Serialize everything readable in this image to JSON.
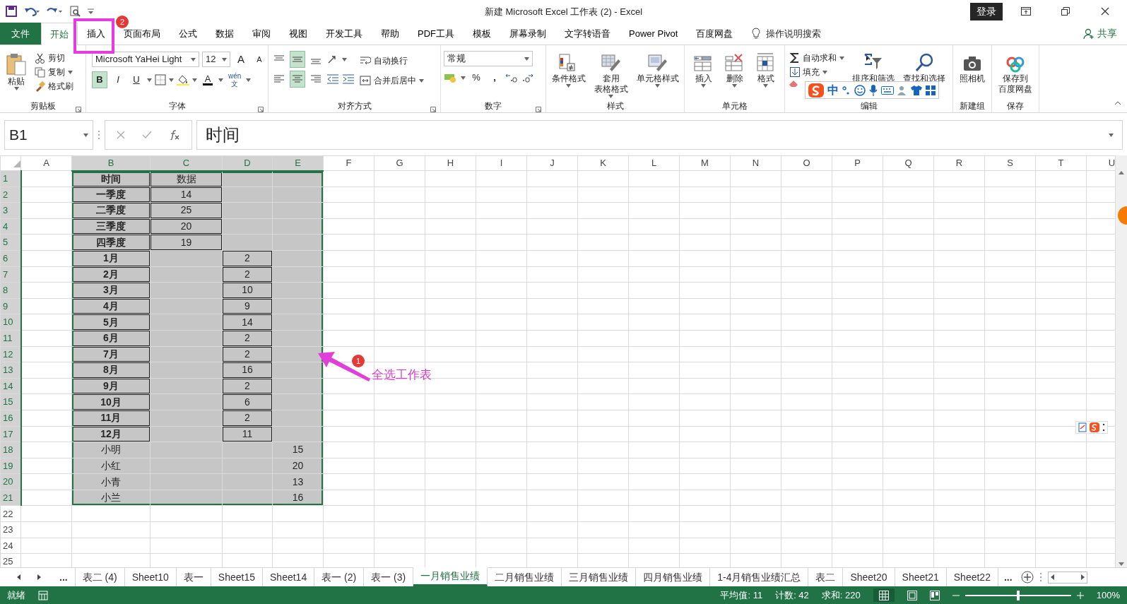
{
  "title_bar": {
    "title": "新建 Microsoft Excel 工作表 (2)  -  Excel",
    "login": "登录"
  },
  "ribbon_tabs": [
    {
      "label": "文件",
      "kind": "file",
      "selected": false
    },
    {
      "label": "开始",
      "kind": "tab",
      "selected": true
    },
    {
      "label": "插入",
      "kind": "tab",
      "selected": false
    },
    {
      "label": "页面布局",
      "kind": "tab",
      "selected": false
    },
    {
      "label": "公式",
      "kind": "tab",
      "selected": false
    },
    {
      "label": "数据",
      "kind": "tab",
      "selected": false
    },
    {
      "label": "审阅",
      "kind": "tab",
      "selected": false
    },
    {
      "label": "视图",
      "kind": "tab",
      "selected": false
    },
    {
      "label": "开发工具",
      "kind": "tab",
      "selected": false
    },
    {
      "label": "帮助",
      "kind": "tab",
      "selected": false
    },
    {
      "label": "PDF工具",
      "kind": "tab",
      "selected": false
    },
    {
      "label": "模板",
      "kind": "tab",
      "selected": false
    },
    {
      "label": "屏幕录制",
      "kind": "tab",
      "selected": false
    },
    {
      "label": "文字转语音",
      "kind": "tab",
      "selected": false
    },
    {
      "label": "Power Pivot",
      "kind": "tab",
      "selected": false
    },
    {
      "label": "百度网盘",
      "kind": "tab",
      "selected": false
    }
  ],
  "tell_me": "操作说明搜索",
  "share": "共享",
  "ribbon_groups": [
    {
      "kind": "clipboard",
      "label": "剪贴板",
      "items": [
        "粘贴",
        "剪切",
        "复制",
        "格式刷"
      ]
    },
    {
      "kind": "font",
      "label": "字体",
      "font_name": "Microsoft YaHei Light",
      "font_size": "12",
      "grow": "A",
      "shrink": "A",
      "font_color": "A",
      "phonetic_top": "wén",
      "phonetic_bottom": "文",
      "styles": [
        {
          "label": "B",
          "selected": true
        },
        {
          "label": "I",
          "selected": false
        },
        {
          "label": "U",
          "selected": false
        }
      ]
    },
    {
      "kind": "alignment",
      "label": "对齐方式",
      "wrap": "自动换行",
      "merge": "合并后居中",
      "vertical": [
        {
          "selected": false
        },
        {
          "selected": true
        },
        {
          "selected": false
        }
      ],
      "horizontal": [
        {
          "selected": false
        },
        {
          "selected": true
        },
        {
          "selected": false
        }
      ]
    },
    {
      "kind": "number",
      "label": "数字",
      "format": "常规",
      "percent": "%",
      "comma": ","
    },
    {
      "kind": "large",
      "label": "样式",
      "items": [
        [
          "条件格式"
        ],
        [
          "套用",
          "表格格式"
        ],
        [
          "单元格样式"
        ]
      ]
    },
    {
      "kind": "large",
      "label": "单元格",
      "items": [
        [
          "插入"
        ],
        [
          "删除"
        ],
        [
          "格式"
        ]
      ]
    },
    {
      "kind": "editing",
      "label": "编辑",
      "small": [
        "自动求和",
        "填充"
      ],
      "items": [
        [
          "排序和筛选"
        ],
        [
          "查找和选择"
        ]
      ]
    },
    {
      "kind": "large",
      "label": "新建组",
      "items": [
        [
          "照相机"
        ]
      ]
    },
    {
      "kind": "large",
      "label": "保存",
      "items": [
        [
          "保存到",
          "百度网盘"
        ]
      ]
    }
  ],
  "ime_bar": {
    "label": "中"
  },
  "formula_bar": {
    "name_box": "B1",
    "content": "时间"
  },
  "sheet": {
    "columns": [
      {
        "label": "A",
        "selected": false
      },
      {
        "label": "B",
        "selected": true
      },
      {
        "label": "C",
        "selected": true
      },
      {
        "label": "D",
        "selected": true
      },
      {
        "label": "E",
        "selected": true
      },
      {
        "label": "F",
        "selected": false
      },
      {
        "label": "G",
        "selected": false
      },
      {
        "label": "H",
        "selected": false
      },
      {
        "label": "I",
        "selected": false
      },
      {
        "label": "J",
        "selected": false
      },
      {
        "label": "K",
        "selected": false
      },
      {
        "label": "L",
        "selected": false
      },
      {
        "label": "M",
        "selected": false
      },
      {
        "label": "N",
        "selected": false
      },
      {
        "label": "O",
        "selected": false
      },
      {
        "label": "P",
        "selected": false
      },
      {
        "label": "Q",
        "selected": false
      },
      {
        "label": "R",
        "selected": false
      },
      {
        "label": "S",
        "selected": false
      },
      {
        "label": "T",
        "selected": false
      },
      {
        "label": "U",
        "selected": false
      }
    ],
    "rows": [
      {
        "header": "1",
        "selected": true,
        "cells": [
          {
            "text": "时间",
            "bold": true,
            "bordered": true,
            "selected": true
          },
          {
            "text": "数据",
            "bold": false,
            "bordered": true,
            "selected": true
          },
          {
            "bordered": false,
            "selected": true
          },
          {
            "bordered": false,
            "selected": true
          }
        ]
      },
      {
        "header": "2",
        "selected": true,
        "cells": [
          {
            "text": "一季度",
            "bold": true,
            "bordered": true,
            "selected": true
          },
          {
            "text": "14",
            "bold": false,
            "bordered": true,
            "selected": true
          },
          {
            "bordered": false,
            "selected": true
          },
          {
            "bordered": false,
            "selected": true
          }
        ]
      },
      {
        "header": "3",
        "selected": true,
        "cells": [
          {
            "text": "二季度",
            "bold": true,
            "bordered": true,
            "selected": true
          },
          {
            "text": "25",
            "bold": false,
            "bordered": true,
            "selected": true
          },
          {
            "bordered": false,
            "selected": true
          },
          {
            "bordered": false,
            "selected": true
          }
        ]
      },
      {
        "header": "4",
        "selected": true,
        "cells": [
          {
            "text": "三季度",
            "bold": true,
            "bordered": true,
            "selected": true
          },
          {
            "text": "20",
            "bold": false,
            "bordered": true,
            "selected": true
          },
          {
            "bordered": false,
            "selected": true
          },
          {
            "bordered": false,
            "selected": true
          }
        ]
      },
      {
        "header": "5",
        "selected": true,
        "cells": [
          {
            "text": "四季度",
            "bold": true,
            "bordered": true,
            "selected": true
          },
          {
            "text": "19",
            "bold": false,
            "bordered": true,
            "selected": true
          },
          {
            "bordered": false,
            "selected": true
          },
          {
            "bordered": false,
            "selected": true
          }
        ]
      },
      {
        "header": "6",
        "selected": true,
        "cells": [
          {
            "text": "1月",
            "bold": true,
            "bordered": true,
            "selected": true
          },
          {
            "bordered": false,
            "selected": true
          },
          {
            "text": "2",
            "bold": false,
            "bordered": true,
            "selected": true
          },
          {
            "bordered": false,
            "selected": true
          }
        ]
      },
      {
        "header": "7",
        "selected": true,
        "cells": [
          {
            "text": "2月",
            "bold": true,
            "bordered": true,
            "selected": true
          },
          {
            "bordered": false,
            "selected": true
          },
          {
            "text": "2",
            "bold": false,
            "bordered": true,
            "selected": true
          },
          {
            "bordered": false,
            "selected": true
          }
        ]
      },
      {
        "header": "8",
        "selected": true,
        "cells": [
          {
            "text": "3月",
            "bold": true,
            "bordered": true,
            "selected": true
          },
          {
            "bordered": false,
            "selected": true
          },
          {
            "text": "10",
            "bold": false,
            "bordered": true,
            "selected": true
          },
          {
            "bordered": false,
            "selected": true
          }
        ]
      },
      {
        "header": "9",
        "selected": true,
        "cells": [
          {
            "text": "4月",
            "bold": true,
            "bordered": true,
            "selected": true
          },
          {
            "bordered": false,
            "selected": true
          },
          {
            "text": "9",
            "bold": false,
            "bordered": true,
            "selected": true
          },
          {
            "bordered": false,
            "selected": true
          }
        ]
      },
      {
        "header": "10",
        "selected": true,
        "cells": [
          {
            "text": "5月",
            "bold": true,
            "bordered": true,
            "selected": true
          },
          {
            "bordered": false,
            "selected": true
          },
          {
            "text": "14",
            "bold": false,
            "bordered": true,
            "selected": true
          },
          {
            "bordered": false,
            "selected": true
          }
        ]
      },
      {
        "header": "11",
        "selected": true,
        "cells": [
          {
            "text": "6月",
            "bold": true,
            "bordered": true,
            "selected": true
          },
          {
            "bordered": false,
            "selected": true
          },
          {
            "text": "2",
            "bold": false,
            "bordered": true,
            "selected": true
          },
          {
            "bordered": false,
            "selected": true
          }
        ]
      },
      {
        "header": "12",
        "selected": true,
        "cells": [
          {
            "text": "7月",
            "bold": true,
            "bordered": true,
            "selected": true
          },
          {
            "bordered": false,
            "selected": true
          },
          {
            "text": "2",
            "bold": false,
            "bordered": true,
            "selected": true
          },
          {
            "bordered": false,
            "selected": true
          }
        ]
      },
      {
        "header": "13",
        "selected": true,
        "cells": [
          {
            "text": "8月",
            "bold": true,
            "bordered": true,
            "selected": true
          },
          {
            "bordered": false,
            "selected": true
          },
          {
            "text": "16",
            "bold": false,
            "bordered": true,
            "selected": true
          },
          {
            "bordered": false,
            "selected": true
          }
        ]
      },
      {
        "header": "14",
        "selected": true,
        "cells": [
          {
            "text": "9月",
            "bold": true,
            "bordered": true,
            "selected": true
          },
          {
            "bordered": false,
            "selected": true
          },
          {
            "text": "2",
            "bold": false,
            "bordered": true,
            "selected": true
          },
          {
            "bordered": false,
            "selected": true
          }
        ]
      },
      {
        "header": "15",
        "selected": true,
        "cells": [
          {
            "text": "10月",
            "bold": true,
            "bordered": true,
            "selected": true
          },
          {
            "bordered": false,
            "selected": true
          },
          {
            "text": "6",
            "bold": false,
            "bordered": true,
            "selected": true
          },
          {
            "bordered": false,
            "selected": true
          }
        ]
      },
      {
        "header": "16",
        "selected": true,
        "cells": [
          {
            "text": "11月",
            "bold": true,
            "bordered": true,
            "selected": true
          },
          {
            "bordered": false,
            "selected": true
          },
          {
            "text": "2",
            "bold": false,
            "bordered": true,
            "selected": true
          },
          {
            "bordered": false,
            "selected": true
          }
        ]
      },
      {
        "header": "17",
        "selected": true,
        "cells": [
          {
            "text": "12月",
            "bold": true,
            "bordered": true,
            "selected": true
          },
          {
            "bordered": false,
            "selected": true
          },
          {
            "text": "11",
            "bold": false,
            "bordered": true,
            "selected": true
          },
          {
            "bordered": false,
            "selected": true
          }
        ]
      },
      {
        "header": "18",
        "selected": true,
        "cells": [
          {
            "text": "小明",
            "bold": false,
            "bordered": false,
            "selected": true
          },
          {
            "bordered": false,
            "selected": true
          },
          {
            "bordered": false,
            "selected": true
          },
          {
            "text": "15",
            "bold": false,
            "bordered": false,
            "selected": true
          }
        ]
      },
      {
        "header": "19",
        "selected": true,
        "cells": [
          {
            "text": "小红",
            "bold": false,
            "bordered": false,
            "selected": true
          },
          {
            "bordered": false,
            "selected": true
          },
          {
            "bordered": false,
            "selected": true
          },
          {
            "text": "20",
            "bold": false,
            "bordered": false,
            "selected": true
          }
        ]
      },
      {
        "header": "20",
        "selected": true,
        "cells": [
          {
            "text": "小青",
            "bold": false,
            "bordered": false,
            "selected": true
          },
          {
            "bordered": false,
            "selected": true
          },
          {
            "bordered": false,
            "selected": true
          },
          {
            "text": "13",
            "bold": false,
            "bordered": false,
            "selected": true
          }
        ]
      },
      {
        "header": "21",
        "selected": true,
        "cells": [
          {
            "text": "小兰",
            "bold": false,
            "bordered": false,
            "selected": true
          },
          {
            "bordered": false,
            "selected": true
          },
          {
            "bordered": false,
            "selected": true
          },
          {
            "text": "16",
            "bold": false,
            "bordered": false,
            "selected": true
          }
        ]
      },
      {
        "header": "22",
        "selected": false
      },
      {
        "header": "23",
        "selected": false
      },
      {
        "header": "24",
        "selected": false
      },
      {
        "header": "25",
        "selected": false
      }
    ]
  },
  "sheet_tabs": {
    "more_left": "...",
    "more_right": "...",
    "tabs": [
      {
        "label": "表二 (4)",
        "selected": false
      },
      {
        "label": "Sheet10",
        "selected": false
      },
      {
        "label": "表一",
        "selected": false
      },
      {
        "label": "Sheet15",
        "selected": false
      },
      {
        "label": "Sheet14",
        "selected": false
      },
      {
        "label": "表一 (2)",
        "selected": false
      },
      {
        "label": "表一 (3)",
        "selected": false
      },
      {
        "label": "一月销售业绩",
        "selected": true
      },
      {
        "label": "二月销售业绩",
        "selected": false
      },
      {
        "label": "三月销售业绩",
        "selected": false
      },
      {
        "label": "四月销售业绩",
        "selected": false
      },
      {
        "label": "1-4月销售业绩汇总",
        "selected": false
      },
      {
        "label": "表二",
        "selected": false
      },
      {
        "label": "Sheet20",
        "selected": false
      },
      {
        "label": "Sheet21",
        "selected": false
      },
      {
        "label": "Sheet22",
        "selected": false
      }
    ]
  },
  "status_bar": {
    "mode": "就绪",
    "average": "平均值: 11",
    "count": "计数: 42",
    "sum": "求和: 220",
    "zoom": "100%",
    "zoom_slider": {
      "level": 0.5
    }
  },
  "annotations": [
    {
      "kind": "tab_marker",
      "badge": "2"
    },
    {
      "kind": "callout",
      "badge": "1",
      "text": "全选工作表"
    }
  ]
}
